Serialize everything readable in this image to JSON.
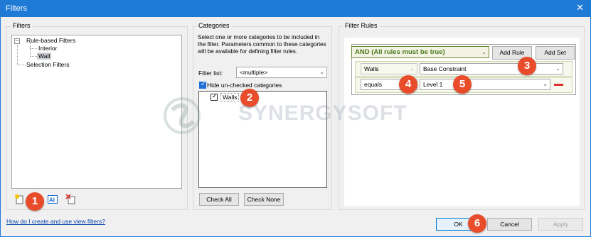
{
  "window": {
    "title": "Filters",
    "close_glyph": "✕"
  },
  "filters": {
    "group_label": "Filters",
    "tree": {
      "root": "Rule-based Filters",
      "children": [
        "Interior",
        "Wall"
      ],
      "selected": "Wall",
      "selection_filters": "Selection Filters"
    },
    "toolbar": [
      "new-filter-icon",
      "rename-filter-icon",
      "delete-filter-icon"
    ]
  },
  "help_link": "How do I create and use view filters?",
  "categories": {
    "group_label": "Categories",
    "description": "Select one or more categories to be included in the filter.  Parameters common to these categories will be available for defining filter rules.",
    "filter_list_label": "Filter list:",
    "filter_list_value": "<multiple>",
    "hide_unchecked_label": "Hide un-checked categories",
    "hide_unchecked_checked": true,
    "items": [
      {
        "label": "Walls",
        "checked": true
      }
    ],
    "check_all": "Check All",
    "check_none": "Check None"
  },
  "filter_rules": {
    "group_label": "Filter Rules",
    "logic": "AND (All rules must be true)",
    "add_rule": "Add Rule",
    "add_set": "Add Set",
    "rule": {
      "category": "Walls",
      "parameter": "Base Constraint",
      "operator": "equals",
      "value": "Level 1"
    }
  },
  "footer": {
    "ok": "OK",
    "cancel": "Cancel",
    "apply": "Apply"
  },
  "badges": [
    "1",
    "2",
    "3",
    "4",
    "5",
    "6"
  ],
  "watermark": "SYNERGYSOFT",
  "colors": {
    "accent": "#1f7ad6",
    "badge": "#e84c2a",
    "logic_text": "#4a7a1a",
    "delete_rule": "#d9322a"
  }
}
